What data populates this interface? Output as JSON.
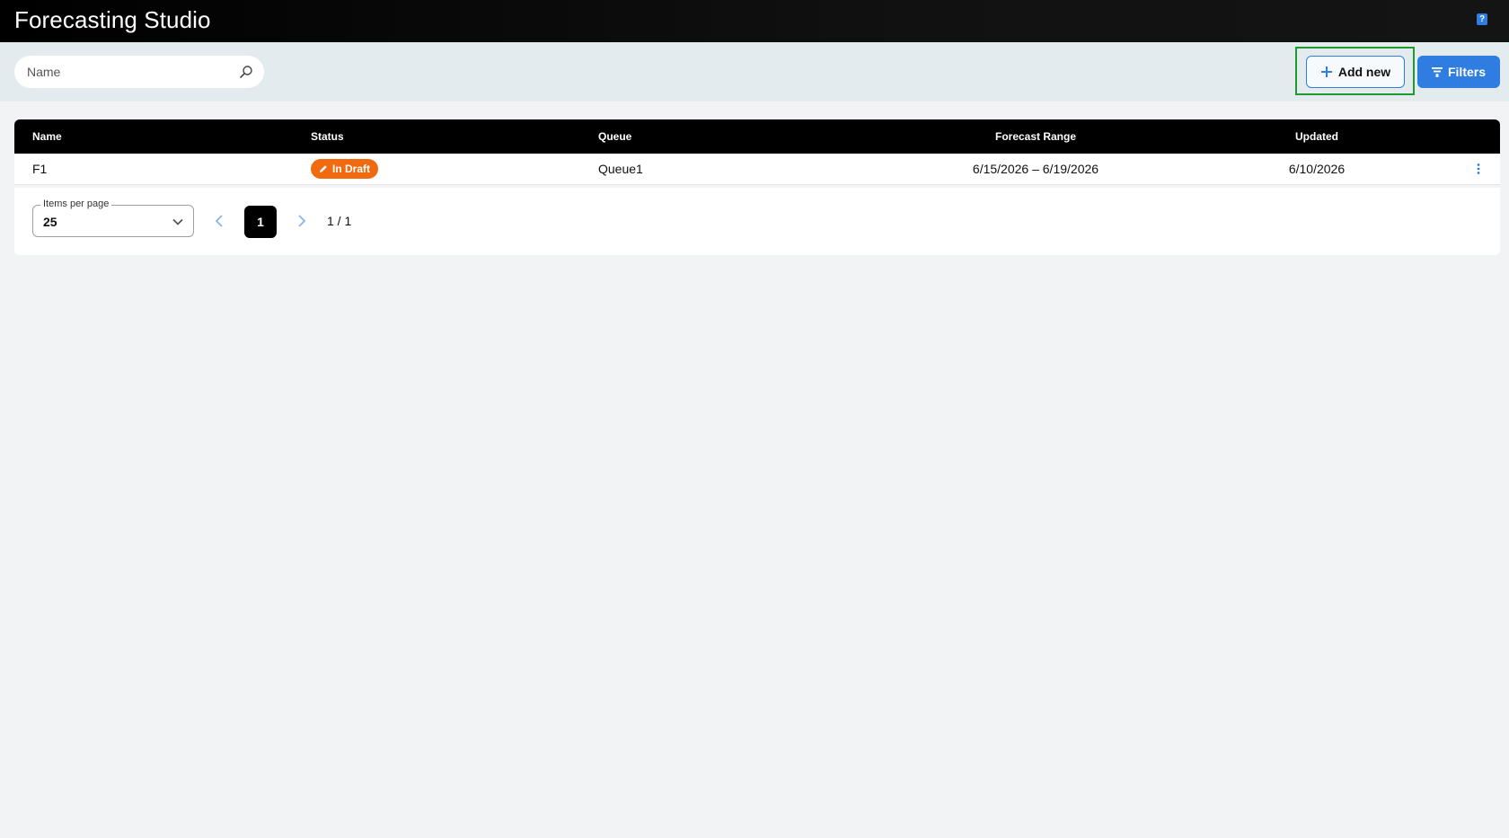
{
  "app": {
    "title": "Forecasting Studio",
    "help_icon": "help-icon",
    "help_glyph": "?"
  },
  "toolbar": {
    "search": {
      "placeholder": "Name",
      "value": "",
      "icon": "search-icon"
    },
    "add_button": {
      "label": "Add new",
      "icon": "plus-icon"
    },
    "filters_button": {
      "label": "Filters",
      "icon": "funnel-icon"
    }
  },
  "table": {
    "columns": [
      "Name",
      "Status",
      "Queue",
      "Forecast Range",
      "Updated"
    ],
    "rows": [
      {
        "name": "F1",
        "status": "In Draft",
        "queue": "Queue1",
        "forecast_range": "6/15/2026 – 6/19/2026",
        "updated": "6/10/2026"
      }
    ]
  },
  "pagination": {
    "items_per_page_label": "Items per page",
    "items_per_page": "25",
    "current_page": "1",
    "page_info": "1 / 1"
  },
  "colors": {
    "accent": "#2f7de1",
    "status_draft": "#f26a10",
    "highlight": "#1e9a2e",
    "header_bg": "#000000"
  }
}
